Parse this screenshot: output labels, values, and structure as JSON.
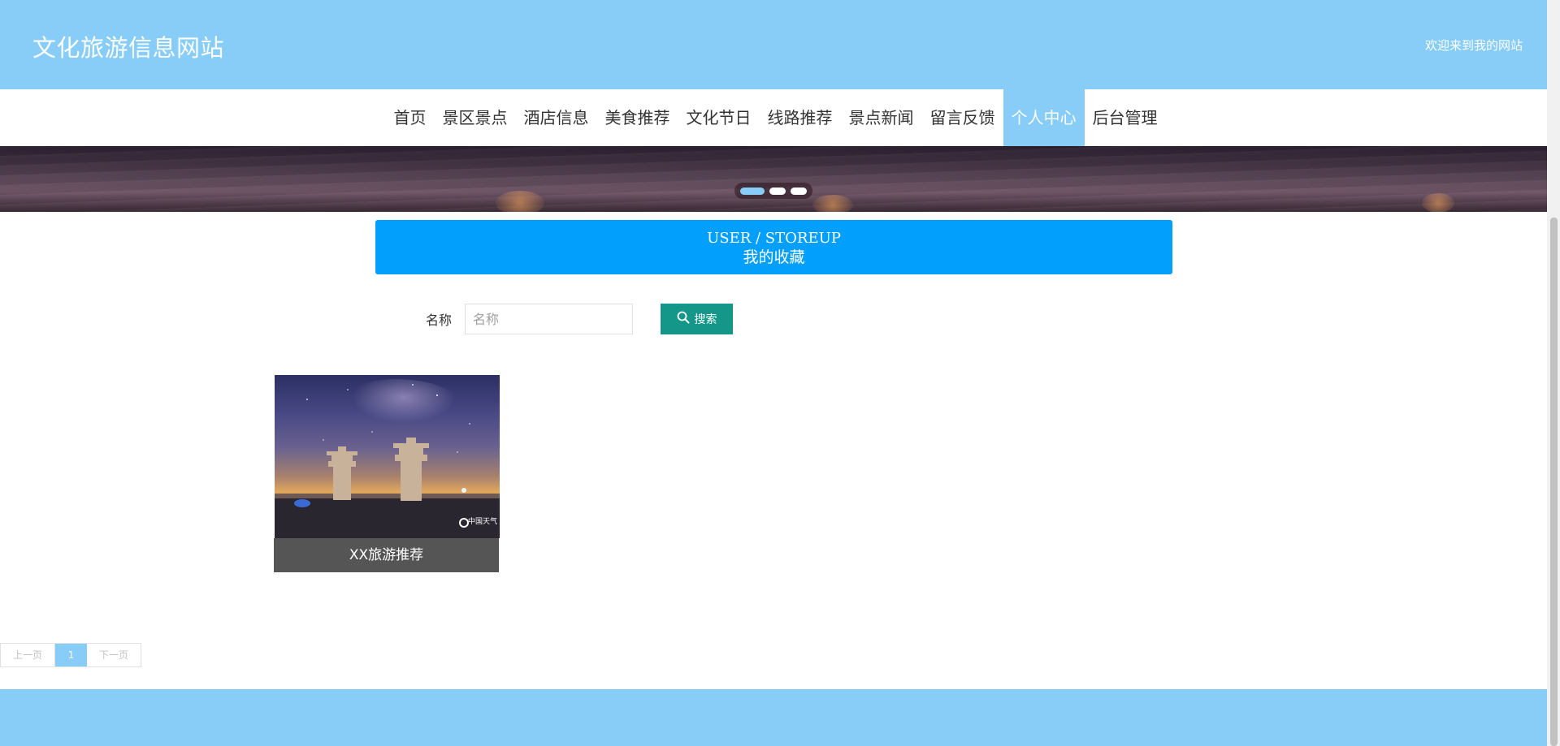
{
  "header": {
    "site_title": "文化旅游信息网站",
    "welcome": "欢迎来到我的网站"
  },
  "nav": {
    "items": [
      {
        "label": "首页"
      },
      {
        "label": "景区景点"
      },
      {
        "label": "酒店信息"
      },
      {
        "label": "美食推荐"
      },
      {
        "label": "文化节日"
      },
      {
        "label": "线路推荐"
      },
      {
        "label": "景点新闻"
      },
      {
        "label": "留言反馈"
      },
      {
        "label": "个人中心",
        "active": true
      },
      {
        "label": "后台管理"
      }
    ]
  },
  "banner": {
    "slide_count": 3,
    "active_index": 0
  },
  "section": {
    "title_en": "USER / STOREUP",
    "title_cn": "我的收藏"
  },
  "search": {
    "label": "名称",
    "placeholder": "名称",
    "value": "",
    "button_label": "搜索"
  },
  "items": [
    {
      "title": "XX旅游推荐",
      "watermark": "中国天气"
    }
  ],
  "pagination": {
    "prev_label": "上一页",
    "current_page": "1",
    "next_label": "下一页"
  },
  "colors": {
    "header_bg": "#87cdf7",
    "section_title_bg": "#039ffd",
    "search_button_bg": "#149688",
    "card_title_bg": "#555555"
  }
}
